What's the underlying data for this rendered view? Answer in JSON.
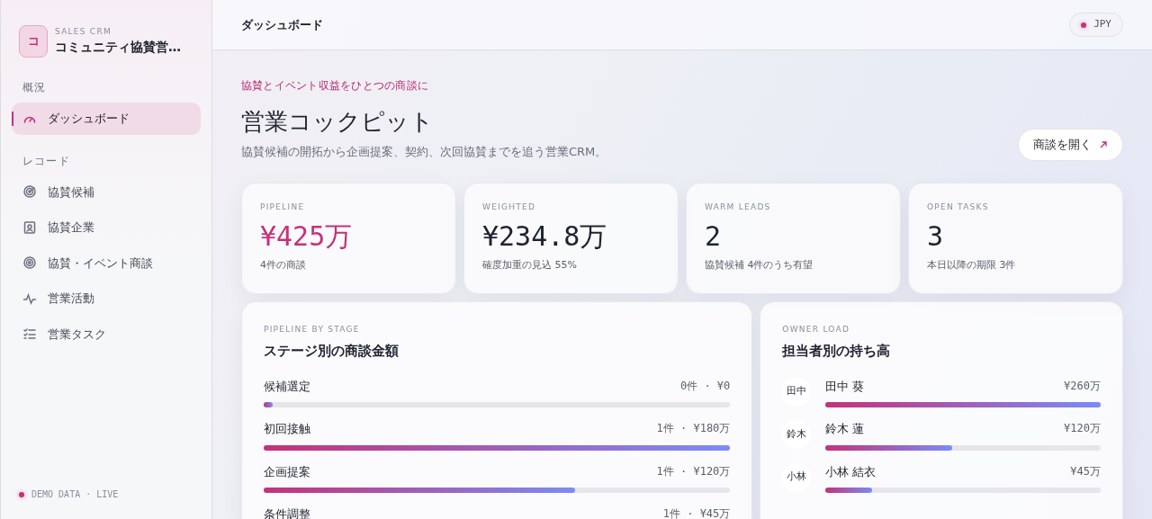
{
  "brand": {
    "logo_letter": "コ",
    "eyebrow": "SALES CRM",
    "title": "コミュニティ協賛営…"
  },
  "sidebar": {
    "sections": [
      {
        "heading": "概況",
        "items": [
          {
            "label": "ダッシュボード",
            "kind": "gauge",
            "selected": true
          }
        ]
      },
      {
        "heading": "レコード",
        "items": [
          {
            "label": "協賛候補",
            "kind": "radar",
            "selected": false
          },
          {
            "label": "協賛企業",
            "kind": "badge",
            "selected": false
          },
          {
            "label": "協賛・イベント商談",
            "kind": "target",
            "selected": false
          },
          {
            "label": "営業活動",
            "kind": "pulse",
            "selected": false
          },
          {
            "label": "営業タスク",
            "kind": "checklist",
            "selected": false
          }
        ]
      }
    ],
    "footer": "DEMO DATA · LIVE"
  },
  "header": {
    "title": "ダッシュボード",
    "currency": "JPY"
  },
  "hero": {
    "eyebrow": "協賛とイベント収益をひとつの商談に",
    "title": "営業コックピット",
    "subtitle": "協賛候補の開拓から企画提案、契約、次回協賛までを追う営業CRM。",
    "button": "商談を開く"
  },
  "kpis": [
    {
      "label": "PIPELINE",
      "value": "¥425万",
      "note": "4件の商談",
      "accent": true
    },
    {
      "label": "WEIGHTED",
      "value": "¥234.8万",
      "note": "確度加重の見込 55%",
      "accent": false
    },
    {
      "label": "WARM LEADS",
      "value": "2",
      "note": "協賛候補 4件のうち有望",
      "accent": false
    },
    {
      "label": "OPEN TASKS",
      "value": "3",
      "note": "本日以降の期限 3件",
      "accent": false
    }
  ],
  "stages": {
    "eyebrow": "PIPELINE BY STAGE",
    "title": "ステージ別の商談金額",
    "rows": [
      {
        "name": "候補選定",
        "amount": "0件 · ¥0",
        "level": 0.02
      },
      {
        "name": "初回接触",
        "amount": "1件 · ¥180万",
        "level": 1.0
      },
      {
        "name": "企画提案",
        "amount": "1件 · ¥120万",
        "level": 0.667
      },
      {
        "name": "条件調整",
        "amount": "1件 · ¥45万"
      }
    ]
  },
  "owners": {
    "eyebrow": "OWNER LOAD",
    "title": "担当者別の持ち高",
    "rows": [
      {
        "initials": "田中",
        "name": "田中 葵",
        "amount": "¥260万",
        "level": 1.0
      },
      {
        "initials": "鈴木",
        "name": "鈴木 蓮",
        "amount": "¥120万",
        "level": 0.46
      },
      {
        "initials": "小林",
        "name": "小林 結衣",
        "amount": "¥45万",
        "level": 0.17
      }
    ]
  }
}
